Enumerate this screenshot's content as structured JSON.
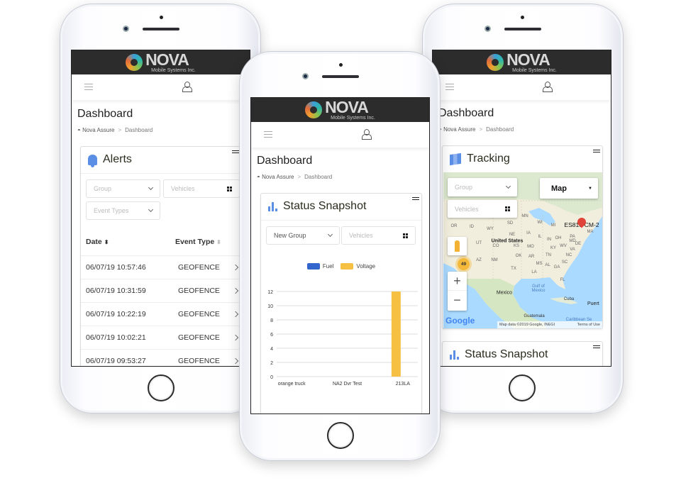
{
  "brand": {
    "name": "NOVA",
    "tagline": "Mobile Systems Inc.",
    "trademark": "TM"
  },
  "common": {
    "page_title": "Dashboard",
    "breadcrumb": [
      "Nova Assure",
      "Dashboard"
    ],
    "breadcrumb_sep": ">"
  },
  "alerts": {
    "title": "Alerts",
    "filters": {
      "group_placeholder": "Group",
      "vehicles_placeholder": "Vehicles",
      "event_types_placeholder": "Event Types"
    },
    "columns": [
      "Date",
      "Event Type"
    ],
    "rows": [
      {
        "date": "06/07/19 10:57:46",
        "type": "GEOFENCE"
      },
      {
        "date": "06/07/19 10:31:59",
        "type": "GEOFENCE"
      },
      {
        "date": "06/07/19 10:22:19",
        "type": "GEOFENCE"
      },
      {
        "date": "06/07/19 10:02:21",
        "type": "GEOFENCE"
      },
      {
        "date": "06/07/19 09:53:27",
        "type": "GEOFENCE"
      }
    ]
  },
  "status": {
    "title": "Status Snapshot",
    "group_value": "New Group",
    "vehicles_placeholder": "Vehicles"
  },
  "chart_data": {
    "type": "bar",
    "categories": [
      "orange truck",
      "NA2 Dvr Test",
      "213LA"
    ],
    "series": [
      {
        "name": "Fuel",
        "color": "#3366cc",
        "values": [
          0,
          0,
          0
        ]
      },
      {
        "name": "Voltage",
        "color": "#f6c142",
        "values": [
          0,
          0,
          12
        ]
      }
    ],
    "ylim": [
      0,
      12
    ],
    "yticks": [
      "0",
      "2",
      "4",
      "6",
      "8",
      "10",
      "12"
    ],
    "grid": true,
    "legend": "top"
  },
  "tracking": {
    "title": "Tracking",
    "group_placeholder": "Group",
    "vehicles_placeholder": "Vehicles",
    "map_type": "Map",
    "marker_label": "ES810-CM-2",
    "cluster_count": "49",
    "labels": {
      "us": "United States",
      "mexico": "Mexico",
      "gulf": "Gulf of Mexico",
      "cuba": "Cuba",
      "guatemala": "Guatemala",
      "puerto": "Puert",
      "caribbean": "Caribbean Se"
    },
    "states": [
      "OR",
      "ID",
      "WY",
      "SD",
      "MN",
      "WI",
      "MI",
      "NE",
      "IA",
      "IL",
      "IN",
      "OH",
      "PA",
      "UT",
      "CO",
      "KS",
      "MO",
      "KY",
      "WV",
      "VA",
      "MD",
      "DE",
      "OK",
      "AR",
      "TN",
      "NC",
      "AZ",
      "NM",
      "TX",
      "MS",
      "AL",
      "GA",
      "SC",
      "LA",
      "FL",
      "MA"
    ],
    "google": "Google",
    "attribution": "Map data ©2019 Google, INEGI",
    "terms": "Terms of Use",
    "zoom_in": "+",
    "zoom_out": "−",
    "second_card_title": "Status Snapshot"
  }
}
